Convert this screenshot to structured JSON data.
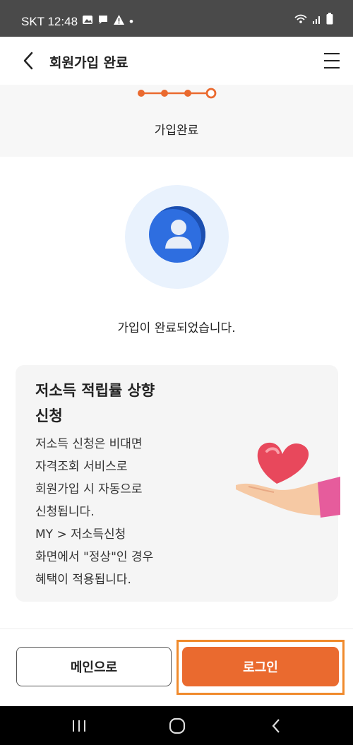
{
  "status_bar": {
    "carrier_time": "SKT 12:48",
    "dot": "•"
  },
  "header": {
    "title": "회원가입 완료"
  },
  "progress": {
    "total_steps": 4,
    "current_step": 4,
    "label": "가입완료"
  },
  "main": {
    "done_text": "가입이 완료되었습니다."
  },
  "card": {
    "title_lines": [
      "저소득 적립률 상향",
      "신청"
    ],
    "body_lines": [
      "저소득 신청은 비대면",
      "자격조회 서비스로",
      "회원가입 시 자동으로",
      "신청됩니다.",
      "MY > 저소득신청",
      "화면에서 \"정상\"인 경우",
      "혜택이 적용됩니다."
    ]
  },
  "buttons": {
    "main_label": "메인으로",
    "login_label": "로그인"
  },
  "colors": {
    "accent": "#ea6a2f",
    "highlight_outline": "#f08a2c",
    "avatar": "#2e6ee0"
  }
}
